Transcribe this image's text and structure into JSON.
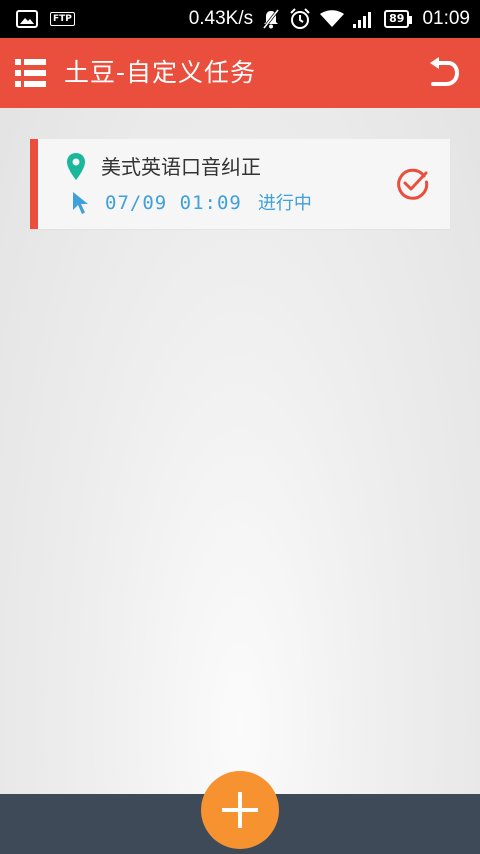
{
  "status_bar": {
    "ftp_label": "FTP",
    "speed": "0.43K/s",
    "battery": "89",
    "time": "01:09"
  },
  "app_bar": {
    "title": "土豆-自定义任务",
    "menu_icon": "list-icon",
    "back_icon": "undo-icon",
    "color": "#ea4f3e"
  },
  "tasks": [
    {
      "title": "美式英语口音纠正",
      "datetime": "07/09 01:09",
      "status": "进行中",
      "pin_color": "#1bb79b",
      "check_color": "#ea4f3e"
    }
  ],
  "bottom": {
    "fab_icon": "plus-icon",
    "fab_color": "#f6922f",
    "bar_color": "#3e4a57"
  }
}
